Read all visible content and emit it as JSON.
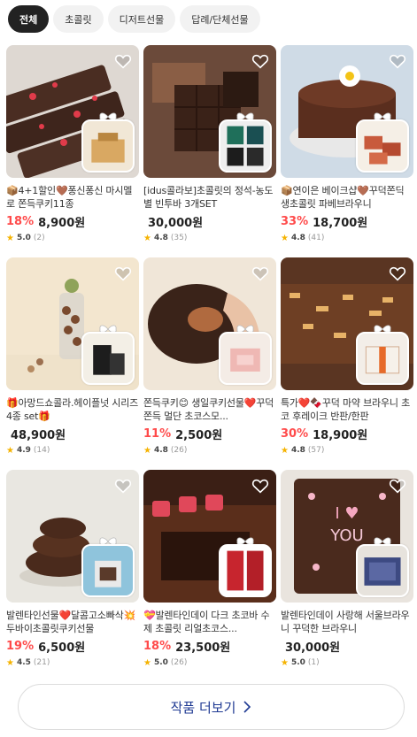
{
  "tabs": [
    "전체",
    "초콜릿",
    "디저트선물",
    "답례/단체선물"
  ],
  "products": [
    {
      "title": "📦4+1할인🤎퐁신퐁신 마시멜로 쫀득쿠키11종",
      "discount": "18%",
      "price": "8,900원",
      "score": "5.0",
      "count": "(2)"
    },
    {
      "title": "[idus콜라보]초콜릿의 정석-농도별 빈투바 3개SET",
      "discount": "",
      "price": "30,000원",
      "score": "4.8",
      "count": "(35)"
    },
    {
      "title": "📦연이은 베이크샵🤎꾸덕쫀딕 생초콜릿 파베브라우니",
      "discount": "33%",
      "price": "18,700원",
      "score": "4.8",
      "count": "(41)"
    },
    {
      "title": "🎁아망드쇼콜라.헤이플넛 시리즈 4종 set🎁",
      "discount": "",
      "price": "48,900원",
      "score": "4.9",
      "count": "(14)"
    },
    {
      "title": "쫀득쿠키😊 생일쿠키선물❤️꾸덕쫀득 멀단 초코스모...",
      "discount": "11%",
      "price": "2,500원",
      "score": "4.8",
      "count": "(26)"
    },
    {
      "title": "특가❤️🍫꾸덕 마약 브라우니 초코 후레이크 반판/한판",
      "discount": "30%",
      "price": "18,900원",
      "score": "4.8",
      "count": "(57)"
    },
    {
      "title": "발렌타인선물❤️달콤고소빠삭💥 두바이초콜릿쿠키선물",
      "discount": "19%",
      "price": "6,500원",
      "score": "4.5",
      "count": "(21)"
    },
    {
      "title": "💝발렌타인데이 다크 초코바 수제 초콜릿 리얼초코스...",
      "discount": "18%",
      "price": "23,500원",
      "score": "5.0",
      "count": "(26)"
    },
    {
      "title": "발렌타인데이 사랑해 서울브라우니 꾸덕한 브라우니",
      "discount": "",
      "price": "30,000원",
      "score": "5.0",
      "count": "(1)"
    }
  ],
  "more_button": {
    "label": "작품 더보기"
  },
  "icons": {
    "heart": "heart-outline-icon",
    "star": "star-icon",
    "chevron": "chevron-right-icon"
  },
  "colors": {
    "discount": "#ff4b4b",
    "star": "#f5b301",
    "more_text": "#1f3a93",
    "active_tab": "#222222"
  }
}
